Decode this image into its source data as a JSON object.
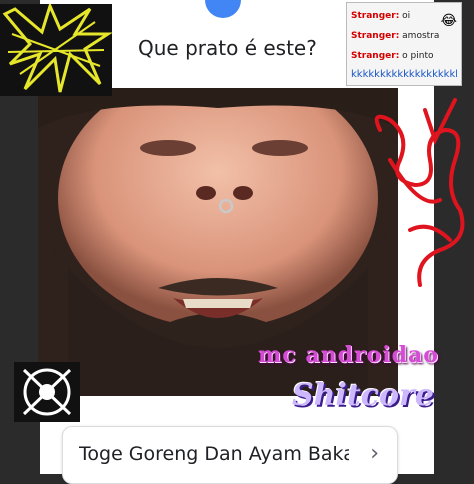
{
  "question": "Que prato é este?",
  "result": {
    "label": "Toge Goreng Dan Ayam Bakar",
    "chevron_icon": "chevron-right-icon"
  },
  "chat": {
    "lines": [
      {
        "who": "Stranger:",
        "msg": "oi"
      },
      {
        "who": "Stranger:",
        "msg": "amostra"
      },
      {
        "who": "Stranger:",
        "msg": "o pinto"
      }
    ],
    "emoji": "😂",
    "kk": "kkkkkkkkkkkkkkkkkkk"
  },
  "captions": {
    "top": "mc androidao",
    "bottom": "Shitcore"
  },
  "colors": {
    "accent": "#4285f4",
    "scribble": "#e0141e",
    "logo_yellow": "#e6e62a"
  }
}
